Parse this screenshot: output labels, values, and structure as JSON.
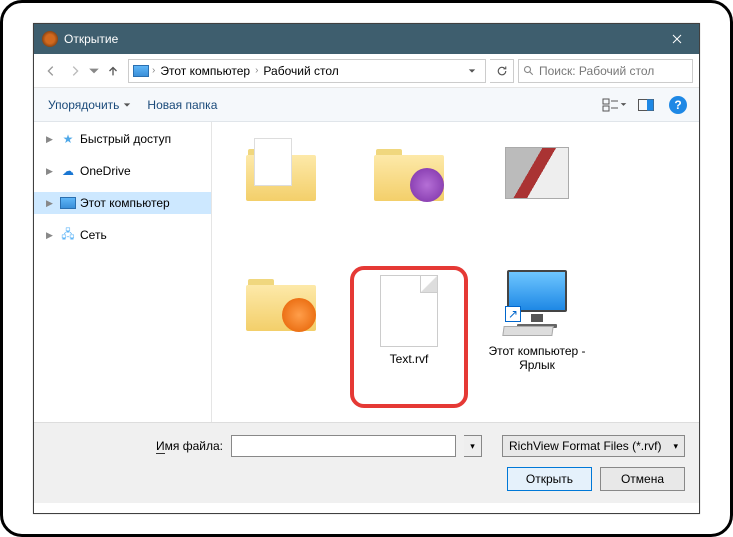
{
  "window": {
    "title": "Открытие"
  },
  "breadcrumb": {
    "seg1": "Этот компьютер",
    "seg2": "Рабочий стол"
  },
  "search": {
    "placeholder": "Поиск: Рабочий стол"
  },
  "toolbar": {
    "organize": "Упорядочить",
    "newfolder": "Новая папка"
  },
  "tree": {
    "quick": "Быстрый доступ",
    "onedrive": "OneDrive",
    "thispc": "Этот компьютер",
    "network": "Сеть"
  },
  "items": {
    "f1": " ",
    "f2": " ",
    "f3": " ",
    "f4": " ",
    "file": "Text.rvf",
    "shortcut": "Этот компьютер - Ярлык"
  },
  "bottom": {
    "filename_label": "Имя файла:",
    "filename_key": "И",
    "filename_value": "",
    "filter": "RichView Format Files (*.rvf)",
    "open": "Открыть",
    "cancel": "Отмена"
  }
}
